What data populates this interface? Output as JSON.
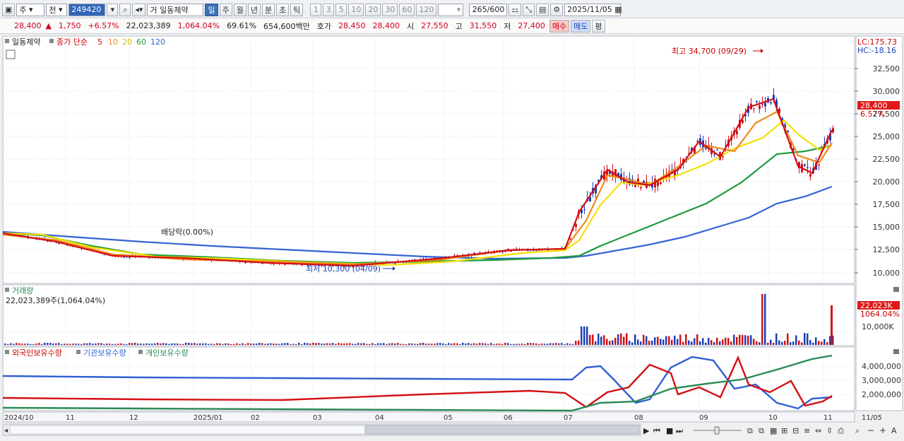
{
  "toolbar": {
    "period_btn": "주",
    "prev_btn": "전",
    "code": "249420",
    "stock_prefix": "거",
    "stock_name": "일동제약",
    "periods": [
      "일",
      "주",
      "월",
      "년",
      "분",
      "초",
      "틱"
    ],
    "active_period": "일",
    "intervals": [
      "1",
      "3",
      "5",
      "10",
      "20",
      "30",
      "60",
      "120"
    ],
    "count": "265",
    "count_max": "/600",
    "date": "2025/11/05"
  },
  "quote": {
    "price": "28,400",
    "change": "1,750",
    "change_pct": "+6.57%",
    "volume": "22,023,389",
    "vol_ratio": "1,064.04%",
    "turnover": "69.61%",
    "amount": "654,600백만",
    "bid_label": "호가",
    "bid": "28,450",
    "ask": "28,400",
    "open_label": "시",
    "open": "27,550",
    "high_label": "고",
    "high": "31,550",
    "low_label": "저",
    "low": "27,400",
    "buy_label": "매수",
    "sell_label": "매도",
    "eval_label": "평"
  },
  "price_panel": {
    "title": "일동제약",
    "ma_label": "종가 단순",
    "ma_periods": [
      "5",
      "10",
      "20",
      "60",
      "120"
    ],
    "ma_colors": [
      "#d40f14",
      "#ee8a1a",
      "#f5e000",
      "#1f9a3c",
      "#3464d4"
    ],
    "lc": "LC:175.73",
    "hc": "HC:-18.16",
    "current_tag": "28,400",
    "current_pct": "6.57%",
    "max_annotation": "최고 34,700 (09/29)",
    "min_annotation": "최저 10,300 (04/09)",
    "event_annotation": "배당락(0.00%)",
    "y_ticks": [
      "32,500",
      "30,000",
      "27,500",
      "25,000",
      "22,500",
      "20,000",
      "17,500",
      "15,000",
      "12,500",
      "10,000"
    ]
  },
  "volume_panel": {
    "title": "거래량",
    "value": "22,023,389주(1,064.04%)",
    "tag": "22,023K",
    "tag_pct": "1064.04%",
    "y_tick": "10,000K"
  },
  "holdings_panel": {
    "series": [
      {
        "name": "외국인보유수량",
        "color": "#d40f14"
      },
      {
        "name": "기관보유수량",
        "color": "#2f5fd4"
      },
      {
        "name": "개인보유수량",
        "color": "#2a8a55"
      }
    ],
    "y_ticks": [
      "4,000,000",
      "3,000,000",
      "2,000,000"
    ]
  },
  "x_axis": [
    "2024/10",
    "11",
    "12",
    "2025/01",
    "02",
    "03",
    "04",
    "05",
    "06",
    "07",
    "08",
    "09",
    "10",
    "11",
    "11/05"
  ]
}
